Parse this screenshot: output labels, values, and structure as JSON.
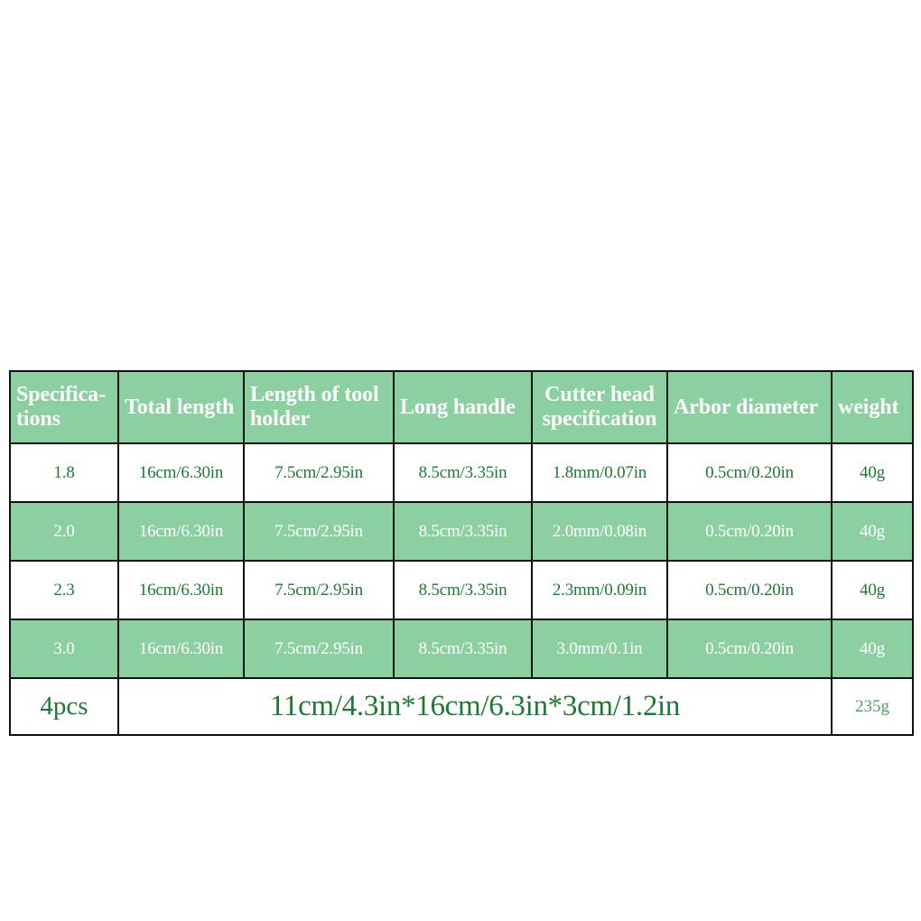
{
  "theme": {
    "header_background": "#8ccfa0",
    "row_green_background": "#8ccfa0",
    "row_white_background": "#ffffff",
    "text_green": "#1d7a33",
    "text_white": "#ffffff",
    "text_light_green": "#4e9e62",
    "border": "#111111"
  },
  "table": {
    "headers": [
      "Specifica-\ntions",
      "Total length",
      "Length of tool holder",
      "Long handle",
      "Cutter head specification",
      "Arbor diameter",
      "weight"
    ],
    "rows": [
      {
        "specification": "1.8",
        "total_length": "16cm/6.30in",
        "tool_holder_length": "7.5cm/2.95in",
        "long_handle": "8.5cm/3.35in",
        "cutter_head_specification": "1.8mm/0.07in",
        "arbor_diameter": "0.5cm/0.20in",
        "weight": "40g"
      },
      {
        "specification": "2.0",
        "total_length": "16cm/6.30in",
        "tool_holder_length": "7.5cm/2.95in",
        "long_handle": "8.5cm/3.35in",
        "cutter_head_specification": "2.0mm/0.08in",
        "arbor_diameter": "0.5cm/0.20in",
        "weight": "40g"
      },
      {
        "specification": "2.3",
        "total_length": "16cm/6.30in",
        "tool_holder_length": "7.5cm/2.95in",
        "long_handle": "8.5cm/3.35in",
        "cutter_head_specification": "2.3mm/0.09in",
        "arbor_diameter": "0.5cm/0.20in",
        "weight": "40g"
      },
      {
        "specification": "3.0",
        "total_length": "16cm/6.30in",
        "tool_holder_length": "7.5cm/2.95in",
        "long_handle": "8.5cm/3.35in",
        "cutter_head_specification": "3.0mm/0.1in",
        "arbor_diameter": "0.5cm/0.20in",
        "weight": "40g"
      }
    ],
    "package_row": {
      "count": "4pcs",
      "dimensions": "11cm/4.3in*16cm/6.3in*3cm/1.2in",
      "weight": "235g"
    }
  }
}
